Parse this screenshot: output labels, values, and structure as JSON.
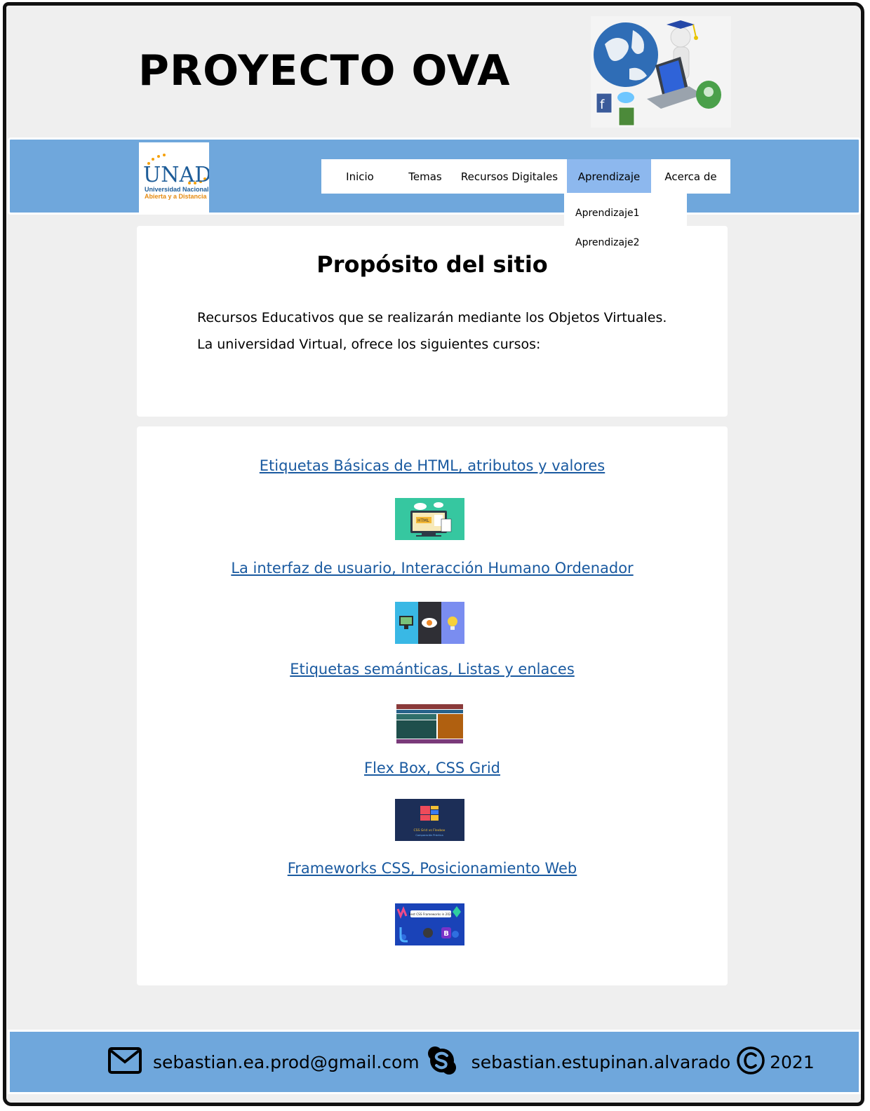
{
  "header": {
    "title": "PROYECTO OVA"
  },
  "logo": {
    "line1": "UNAD",
    "line2": "Universidad Nacional",
    "line3": "Abierta y a Distancia"
  },
  "nav": {
    "items": [
      {
        "label": "Inicio"
      },
      {
        "label": "Temas"
      },
      {
        "label": "Recursos Digitales"
      },
      {
        "label": "Aprendizaje",
        "active": true
      },
      {
        "label": "Acerca de"
      }
    ],
    "dropdown": [
      {
        "label": "Aprendizaje1"
      },
      {
        "label": "Aprendizaje2"
      }
    ]
  },
  "purpose": {
    "title": "Propósito del sitio",
    "line1": "Recursos Educativos que se realizarán mediante los Objetos Virtuales.",
    "line2": "La universidad Virtual, ofrece los siguientes cursos:"
  },
  "courses": [
    {
      "label": "Etiquetas Básicas de HTML, atributos y valores",
      "thumb": "html-tags-thumbnail"
    },
    {
      "label": "La interfaz de usuario, Interacción Humano Ordenador",
      "thumb": "hci-thumbnail"
    },
    {
      "label": "Etiquetas semánticas, Listas y enlaces",
      "thumb": "semantic-layout-thumbnail"
    },
    {
      "label": "Flex Box, CSS Grid",
      "thumb": "css-grid-thumbnail"
    },
    {
      "label": "Frameworks CSS, Posicionamiento Web",
      "thumb": "css-frameworks-thumbnail"
    }
  ],
  "thumb_text": {
    "html": "HTML",
    "grid": "CSS Grid vs Flexbox",
    "grid_sub": "Comparación Práctica",
    "frameworks": "Best CSS Frameworks in 2022",
    "frameworks_b": "B"
  },
  "footer": {
    "email": "sebastian.ea.prod@gmail.com",
    "skype": "sebastian.estupinan.alvarado",
    "copyright_year": "2021",
    "icons": [
      "mail-icon",
      "skype-icon",
      "copyright-icon"
    ]
  },
  "colors": {
    "band": "#6fa7dc",
    "active_menu": "#8db8ee",
    "link": "#1a5aa0"
  }
}
